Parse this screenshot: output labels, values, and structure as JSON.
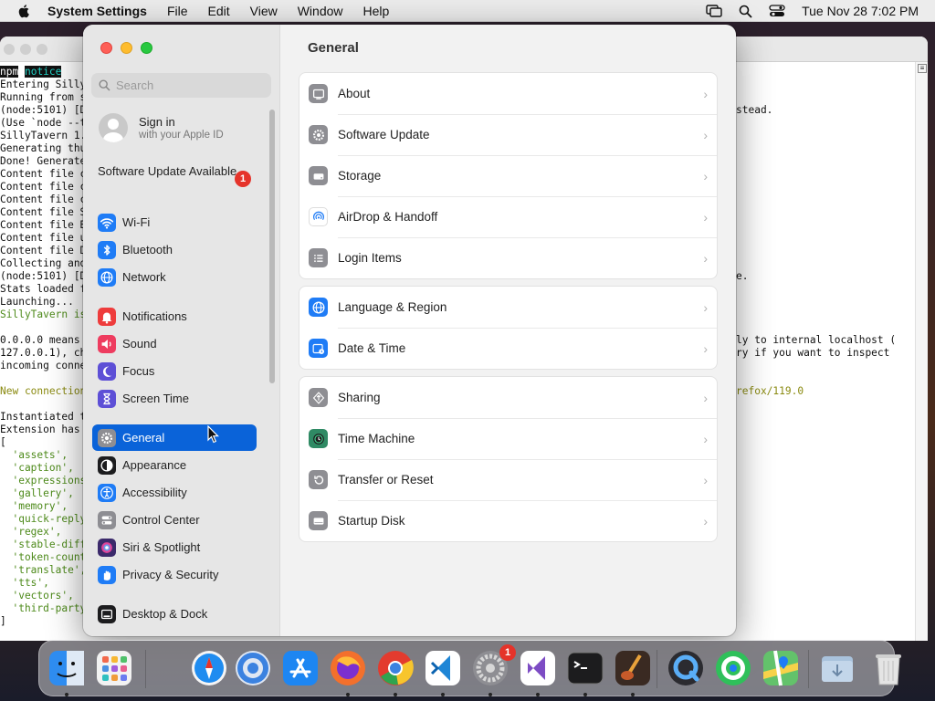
{
  "menubar": {
    "app_name": "System Settings",
    "items": [
      "File",
      "Edit",
      "View",
      "Window",
      "Help"
    ],
    "datetime": "Tue Nov 28  7:02 PM"
  },
  "terminal": {
    "left_lines": [
      "npm notice",
      "Entering Silly",
      "Running from s",
      "(node:5101) [D",
      "(Use `node --t",
      "SillyTavern 1.",
      "Generating thu",
      "Done! Generate",
      "Content file c",
      "Content file c",
      "Content file c",
      "Content file S",
      "Content file B",
      "Content file u",
      "Content file D",
      "Collecting and",
      "(node:5101) [D",
      "Stats loaded f",
      "Launching...",
      "SillyTavern is",
      "",
      "0.0.0.0 means",
      "127.0.0.1), ch",
      "incoming conne",
      "",
      "New connection",
      "",
      "Instantiated t",
      "Extension has",
      "[",
      "  'assets',",
      "  'caption',",
      "  'expressions",
      "  'gallery',",
      "  'memory',",
      "  'quick-reply",
      "  'regex',",
      "  'stable-diff",
      "  'token-count",
      "  'translate',",
      "  'tts',",
      "  'vectors',",
      "  'third-party",
      "]"
    ],
    "right_lines": [
      "",
      "",
      "",
      "stead.",
      "",
      "",
      "",
      "",
      "",
      "",
      "",
      "",
      "",
      "",
      "",
      "",
      "e.",
      "",
      "",
      "",
      "",
      "ly to internal localhost (",
      "ry if you want to inspect",
      "",
      "",
      "refox/119.0"
    ]
  },
  "sidebar": {
    "search_placeholder": "Search",
    "signin_title": "Sign in",
    "signin_subtitle": "with your Apple ID",
    "software_update_label": "Software Update Available",
    "software_update_badge": "1",
    "items": [
      {
        "label": "Wi-Fi",
        "icon": "wifi-icon",
        "color": "#1f7cf6"
      },
      {
        "label": "Bluetooth",
        "icon": "bluetooth-icon",
        "color": "#1f7cf6"
      },
      {
        "label": "Network",
        "icon": "globe-icon",
        "color": "#1f7cf6"
      },
      {
        "label": "Notifications",
        "icon": "bell-icon",
        "color": "#ee3c3c"
      },
      {
        "label": "Sound",
        "icon": "speaker-icon",
        "color": "#ee3c5f"
      },
      {
        "label": "Focus",
        "icon": "moon-icon",
        "color": "#5d4fd6"
      },
      {
        "label": "Screen Time",
        "icon": "hourglass-icon",
        "color": "#5d4fd6"
      },
      {
        "label": "General",
        "icon": "gear-icon",
        "color": "#8e8e93"
      },
      {
        "label": "Appearance",
        "icon": "appearance-icon",
        "color": "#1c1c1e"
      },
      {
        "label": "Accessibility",
        "icon": "accessibility-icon",
        "color": "#1f7cf6"
      },
      {
        "label": "Control Center",
        "icon": "toggles-icon",
        "color": "#8e8e93"
      },
      {
        "label": "Siri & Spotlight",
        "icon": "siri-icon",
        "color": "#3b2a6b"
      },
      {
        "label": "Privacy & Security",
        "icon": "hand-icon",
        "color": "#1f7cf6"
      },
      {
        "label": "Desktop & Dock",
        "icon": "dock-icon",
        "color": "#1c1c1e"
      }
    ],
    "active_item": "General"
  },
  "main": {
    "title": "General",
    "groups": [
      [
        {
          "label": "About",
          "icon": "mac-icon",
          "color": "#8e8e93"
        },
        {
          "label": "Software Update",
          "icon": "gear-badge-icon",
          "color": "#8e8e93"
        },
        {
          "label": "Storage",
          "icon": "drive-icon",
          "color": "#8e8e93"
        },
        {
          "label": "AirDrop & Handoff",
          "icon": "airdrop-icon",
          "color": "#ffffff"
        },
        {
          "label": "Login Items",
          "icon": "list-icon",
          "color": "#8e8e93"
        }
      ],
      [
        {
          "label": "Language & Region",
          "icon": "globe-icon",
          "color": "#1f7cf6"
        },
        {
          "label": "Date & Time",
          "icon": "calendar-clock-icon",
          "color": "#1f7cf6"
        }
      ],
      [
        {
          "label": "Sharing",
          "icon": "sharing-icon",
          "color": "#8e8e93"
        },
        {
          "label": "Time Machine",
          "icon": "time-machine-icon",
          "color": "#2f8a64"
        },
        {
          "label": "Transfer or Reset",
          "icon": "reset-icon",
          "color": "#8e8e93"
        },
        {
          "label": "Startup Disk",
          "icon": "disk-icon",
          "color": "#8e8e93"
        }
      ]
    ]
  },
  "dock": {
    "items": [
      {
        "name": "finder-icon",
        "color": "#2e8cf0",
        "running": true
      },
      {
        "name": "launchpad-icon",
        "color": "#f2f2f2",
        "running": false
      },
      {
        "name": "safari-icon",
        "color": "#1f8cf0",
        "running": false
      },
      {
        "name": "chromium-icon",
        "color": "#3b82e0",
        "running": false
      },
      {
        "name": "app-store-icon",
        "color": "#1d86f2",
        "running": false
      },
      {
        "name": "firefox-icon",
        "color": "#f3702c",
        "running": true
      },
      {
        "name": "chrome-icon",
        "color": "#f2f2f2",
        "running": true
      },
      {
        "name": "vscode-icon",
        "color": "#ffffff",
        "running": true
      },
      {
        "name": "system-settings-icon",
        "color": "#8e8e93",
        "running": true,
        "badge": "1"
      },
      {
        "name": "visual-studio-icon",
        "color": "#ffffff",
        "running": true
      },
      {
        "name": "terminal-icon",
        "color": "#1c1c1e",
        "running": true
      },
      {
        "name": "instruments-icon",
        "color": "#3a2a22",
        "running": true
      },
      {
        "name": "quicktime-icon",
        "color": "#2b2b30",
        "running": false
      },
      {
        "name": "find-my-icon",
        "color": "#2fc05a",
        "running": false
      },
      {
        "name": "maps-icon",
        "color": "#63c26b",
        "running": false
      },
      {
        "name": "downloads-folder-icon",
        "color": "#a9c2dc",
        "running": false
      },
      {
        "name": "trash-icon",
        "color": "#e4e4e4",
        "running": false
      }
    ]
  }
}
